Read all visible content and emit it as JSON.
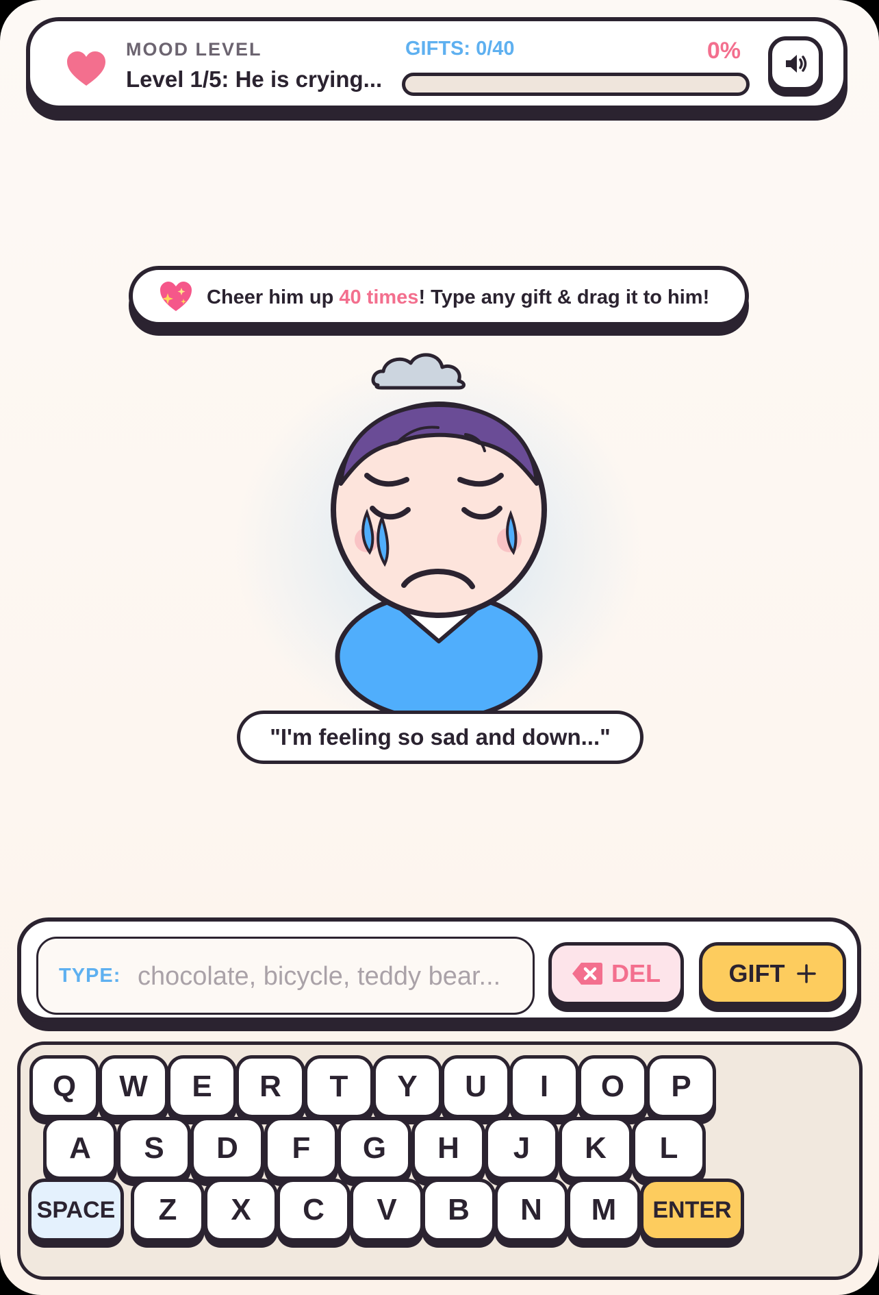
{
  "hud": {
    "mood_label": "MOOD LEVEL",
    "level_text": "Level 1/5: He is crying...",
    "gifts_label": "GIFTS: 0/40",
    "percent_label": "0%",
    "progress": 0,
    "heart_icon": "heart-icon",
    "sound_icon": "speaker-icon"
  },
  "instruction": {
    "prefix": "Cheer him up ",
    "highlight": "40 times",
    "suffix": "! Type any gift & drag it to him!",
    "icon": "sparkling-heart-icon"
  },
  "character": {
    "speech": "\"I'm feeling so sad and down...\""
  },
  "input": {
    "type_label": "TYPE:",
    "placeholder": "chocolate, bicycle, teddy bear...",
    "value": "",
    "del_label": "DEL",
    "gift_label": "GIFT",
    "gift_icon": "plus-icon",
    "del_icon": "backspace-icon"
  },
  "keyboard": {
    "row1": [
      "Q",
      "W",
      "E",
      "R",
      "T",
      "Y",
      "U",
      "I",
      "O",
      "P"
    ],
    "row2": [
      "A",
      "S",
      "D",
      "F",
      "G",
      "H",
      "J",
      "K",
      "L"
    ],
    "row3": [
      "SPACE",
      "Z",
      "X",
      "C",
      "V",
      "B",
      "N",
      "M",
      "ENTER"
    ]
  },
  "colors": {
    "ink": "#2b2330",
    "pink": "#f36f8e",
    "blue": "#5eb0f0",
    "yellow": "#fdcc5e",
    "shirt": "#50aefc",
    "hair": "#6a4c96"
  }
}
